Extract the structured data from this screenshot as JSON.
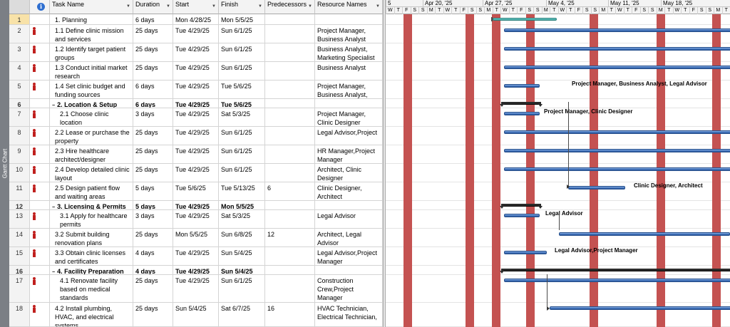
{
  "sidebar": {
    "label": "Gantt Chart"
  },
  "columns": {
    "info_icon": "i",
    "task_name": "Task Name",
    "duration": "Duration",
    "start": "Start",
    "finish": "Finish",
    "predecessors": "Predecessors",
    "resource_names": "Resource Names"
  },
  "tasks": [
    {
      "id": "1",
      "name": "1. Planning",
      "dur": "6 days",
      "start": "Mon 4/28/25",
      "finish": "Mon 5/5/25",
      "pred": "",
      "res": ""
    },
    {
      "id": "2",
      "name": "1.1 Define clinic mission and services",
      "dur": "25 days",
      "start": "Tue 4/29/25",
      "finish": "Sun 6/1/25",
      "pred": "",
      "res": "Project Manager, Business Analyst"
    },
    {
      "id": "3",
      "name": "1.2 Identify target patient groups",
      "dur": "25 days",
      "start": "Tue 4/29/25",
      "finish": "Sun 6/1/25",
      "pred": "",
      "res": "Business Analyst, Marketing Specialist"
    },
    {
      "id": "4",
      "name": "1.3 Conduct initial market research",
      "dur": "25 days",
      "start": "Tue 4/29/25",
      "finish": "Sun 6/1/25",
      "pred": "",
      "res": "Business Analyst"
    },
    {
      "id": "5",
      "name": "1.4 Set clinic budget and funding sources",
      "dur": "6 days",
      "start": "Tue 4/29/25",
      "finish": "Tue 5/6/25",
      "pred": "",
      "res": "Project Manager, Business Analyst,"
    },
    {
      "id": "6",
      "name": "2. Location & Setup",
      "dur": "6 days",
      "start": "Tue 4/29/25",
      "finish": "Tue 5/6/25",
      "pred": "",
      "res": ""
    },
    {
      "id": "7",
      "name": "2.1 Choose clinic location",
      "dur": "3 days",
      "start": "Tue 4/29/25",
      "finish": "Sat 5/3/25",
      "pred": "",
      "res": "Project Manager, Clinic Designer"
    },
    {
      "id": "8",
      "name": "2.2 Lease or purchase the property",
      "dur": "25 days",
      "start": "Tue 4/29/25",
      "finish": "Sun 6/1/25",
      "pred": "",
      "res": "Legal Advisor,Project"
    },
    {
      "id": "9",
      "name": "2.3 Hire healthcare architect/designer",
      "dur": "25 days",
      "start": "Tue 4/29/25",
      "finish": "Sun 6/1/25",
      "pred": "",
      "res": "HR Manager,Project Manager"
    },
    {
      "id": "10",
      "name": "2.4 Develop detailed clinic layout",
      "dur": "25 days",
      "start": "Tue 4/29/25",
      "finish": "Sun 6/1/25",
      "pred": "",
      "res": "Architect, Clinic Designer"
    },
    {
      "id": "11",
      "name": "2.5 Design patient flow and waiting areas",
      "dur": "5 days",
      "start": "Tue 5/6/25",
      "finish": "Tue 5/13/25",
      "pred": "6",
      "res": "Clinic Designer, Architect"
    },
    {
      "id": "12",
      "name": "3. Licensing & Permits",
      "dur": "5 days",
      "start": "Tue 4/29/25",
      "finish": "Mon 5/5/25",
      "pred": "",
      "res": ""
    },
    {
      "id": "13",
      "name": "3.1 Apply for healthcare permits",
      "dur": "3 days",
      "start": "Tue 4/29/25",
      "finish": "Sat 5/3/25",
      "pred": "",
      "res": "Legal Advisor"
    },
    {
      "id": "14",
      "name": "3.2 Submit building renovation plans",
      "dur": "25 days",
      "start": "Mon 5/5/25",
      "finish": "Sun 6/8/25",
      "pred": "12",
      "res": "Architect, Legal Advisor"
    },
    {
      "id": "15",
      "name": "3.3 Obtain clinic licenses and certificates",
      "dur": "4 days",
      "start": "Tue 4/29/25",
      "finish": "Sun 5/4/25",
      "pred": "",
      "res": "Legal Advisor,Project Manager"
    },
    {
      "id": "16",
      "name": "4. Facility Preparation",
      "dur": "4 days",
      "start": "Tue 4/29/25",
      "finish": "Sun 5/4/25",
      "pred": "",
      "res": ""
    },
    {
      "id": "17",
      "name": "4.1 Renovate facility based on medical standards",
      "dur": "25 days",
      "start": "Tue 4/29/25",
      "finish": "Sun 6/1/25",
      "pred": "",
      "res": "Construction Crew,Project Manager"
    },
    {
      "id": "18",
      "name": "4.2 Install plumbing, HVAC, and electrical systems",
      "dur": "25 days",
      "start": "Sun 5/4/25",
      "finish": "Sat 6/7/25",
      "pred": "16",
      "res": "HVAC Technician, Electrical Technician,"
    }
  ],
  "timeline": {
    "weeks": [
      "5",
      "Apr 20, '25",
      "Apr 27, '25",
      "May 4, '25",
      "May 11, '25",
      "May 18, '25"
    ],
    "day_letters": [
      "W",
      "T",
      "F",
      "S",
      "S",
      "M",
      "T",
      "W",
      "T",
      "F",
      "S",
      "S",
      "M",
      "T",
      "W",
      "T",
      "F",
      "S",
      "S",
      "M",
      "T",
      "W",
      "T",
      "F",
      "S",
      "S",
      "M",
      "T",
      "W",
      "T",
      "F",
      "S",
      "S",
      "M",
      "T",
      "W",
      "T",
      "F",
      "S",
      "S",
      "M",
      "T"
    ]
  },
  "bar_labels": {
    "row5": "Project Manager, Business Analyst, Legal Advisor",
    "row7": "Project Manager, Clinic Designer",
    "row11": "Clinic Designer, Architect",
    "row13": "Legal Advisor",
    "row15": "Legal Advisor,Project Manager"
  },
  "colors": {
    "nonworking": "#c45251",
    "task_bar": "#3b6eb9",
    "summary_bar": "#45b1ad",
    "manual_icon": "#c0201e",
    "selected_row": "#f8e2a8"
  }
}
